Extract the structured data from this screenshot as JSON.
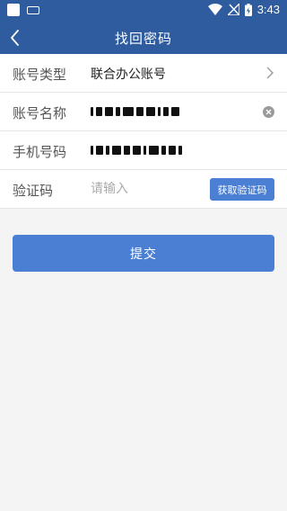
{
  "status_bar": {
    "time": "3:43",
    "icons": [
      "app-notification-icon",
      "keyboard-icon",
      "wifi-icon",
      "signal-icon",
      "battery-charging-icon"
    ]
  },
  "nav": {
    "title": "找回密码",
    "back_icon": "chevron-left-icon"
  },
  "form": {
    "account_type": {
      "label": "账号类型",
      "value": "联合办公账号"
    },
    "account_name": {
      "label": "账号名称",
      "value_masked": true
    },
    "phone": {
      "label": "手机号码",
      "value_masked": true
    },
    "code": {
      "label": "验证码",
      "placeholder": "请输入",
      "button_label": "获取验证码"
    }
  },
  "submit_label": "提交",
  "colors": {
    "primary": "#2f5c9f",
    "button": "#4a7fd3",
    "background": "#f4f4f4"
  }
}
